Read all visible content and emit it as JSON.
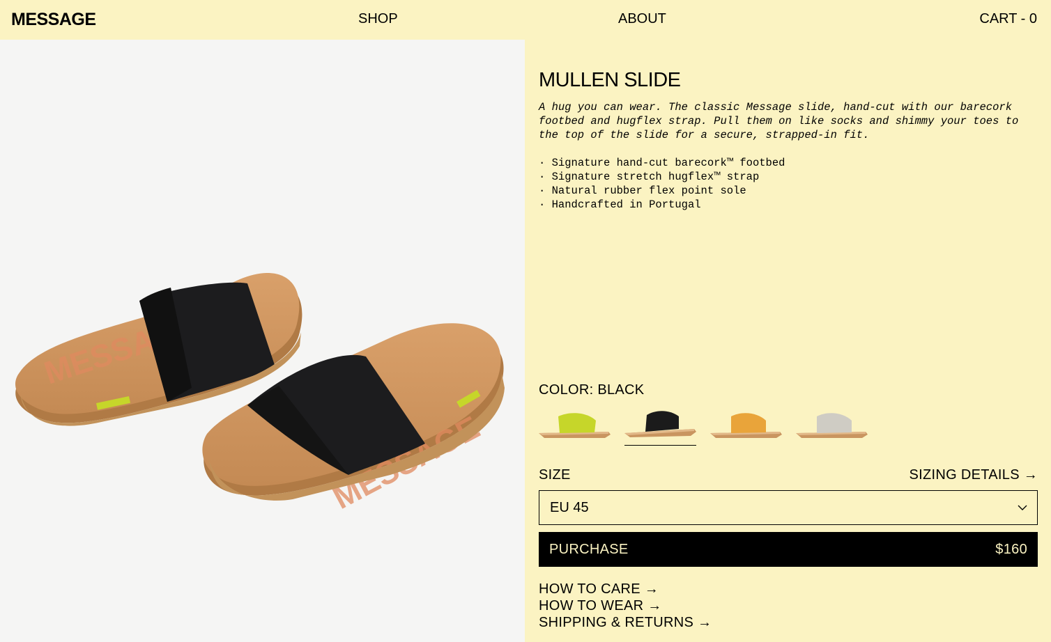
{
  "header": {
    "logo": "MESSAGE",
    "nav_shop": "SHOP",
    "nav_about": "ABOUT",
    "cart": "CART - 0"
  },
  "product": {
    "title": "MULLEN SLIDE",
    "description": "A hug you can wear. The classic Message slide, hand-cut with our barecork footbed and hugflex strap. Pull them on like socks and shimmy your toes to the top of the slide for a secure, strapped-in fit.",
    "features": [
      "Signature hand-cut barecork™ footbed",
      "Signature stretch hugflex™ strap",
      "Natural rubber flex point sole",
      "Handcrafted in Portugal"
    ],
    "photo_wordmark": "MESSAGE"
  },
  "color": {
    "label": "COLOR: BLACK",
    "swatches": [
      {
        "name": "lime",
        "strap": "#c6d62a",
        "selected": false
      },
      {
        "name": "black",
        "strap": "#1b1b1b",
        "selected": true
      },
      {
        "name": "orange",
        "strap": "#e9a43a",
        "selected": false
      },
      {
        "name": "grey",
        "strap": "#cfccc4",
        "selected": false
      }
    ]
  },
  "size": {
    "label": "SIZE",
    "sizing_link": "SIZING DETAILS →",
    "selected": "EU 45"
  },
  "purchase": {
    "label": "PURCHASE",
    "price": "$160"
  },
  "links": {
    "care": "HOW TO CARE →",
    "wear": "HOW TO WEAR →",
    "shipping": "SHIPPING & RETURNS →"
  }
}
